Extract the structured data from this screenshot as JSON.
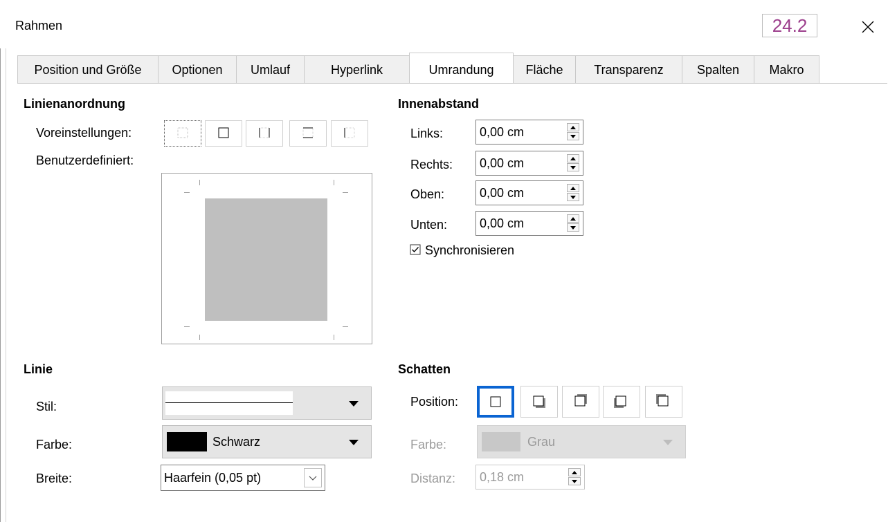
{
  "window": {
    "title": "Rahmen",
    "version_badge": "24.2",
    "close_label": "×"
  },
  "tabs": [
    {
      "label": "Position und Größe",
      "active": false
    },
    {
      "label": "Optionen",
      "active": false
    },
    {
      "label": "Umlauf",
      "active": false
    },
    {
      "label": "Hyperlink",
      "active": false
    },
    {
      "label": "Umrandung",
      "active": true
    },
    {
      "label": "Fläche",
      "active": false
    },
    {
      "label": "Transparenz",
      "active": false
    },
    {
      "label": "Spalten",
      "active": false
    },
    {
      "label": "Makro",
      "active": false
    }
  ],
  "line_arrangement": {
    "heading": "Linienanordnung",
    "presets_label": "Voreinstellungen:",
    "presets": [
      {
        "icon": "no-border-icon",
        "selected": true
      },
      {
        "icon": "outer-border-icon",
        "selected": false
      },
      {
        "icon": "left-right-border-icon",
        "selected": false
      },
      {
        "icon": "top-bottom-border-icon",
        "selected": false
      },
      {
        "icon": "left-border-icon",
        "selected": false
      }
    ],
    "user_defined_label": "Benutzerdefiniert:"
  },
  "padding": {
    "heading": "Innenabstand",
    "fields": [
      {
        "label": "Links:",
        "value": "0,00 cm"
      },
      {
        "label": "Rechts:",
        "value": "0,00 cm"
      },
      {
        "label": "Oben:",
        "value": "0,00 cm"
      },
      {
        "label": "Unten:",
        "value": "0,00 cm"
      }
    ],
    "sync_label": "Synchronisieren",
    "sync_checked": true
  },
  "line": {
    "heading": "Linie",
    "style_label": "Stil:",
    "color_label": "Farbe:",
    "color_value": "Schwarz",
    "color_swatch": "#000000",
    "width_label": "Breite:",
    "width_value": "Haarfein (0,05 pt)"
  },
  "shadow": {
    "heading": "Schatten",
    "position_label": "Position:",
    "positions": [
      {
        "icon": "no-shadow-icon",
        "selected": true
      },
      {
        "icon": "shadow-bottom-right-icon",
        "selected": false
      },
      {
        "icon": "shadow-top-right-icon",
        "selected": false
      },
      {
        "icon": "shadow-bottom-left-icon",
        "selected": false
      },
      {
        "icon": "shadow-top-left-icon",
        "selected": false
      }
    ],
    "color_label": "Farbe:",
    "color_value": "Grau",
    "color_swatch": "#c8c8c8",
    "distance_label": "Distanz:",
    "distance_value": "0,18 cm"
  },
  "colors": {
    "accent": "#0a64d2",
    "version_badge": "#9c3e8c"
  }
}
